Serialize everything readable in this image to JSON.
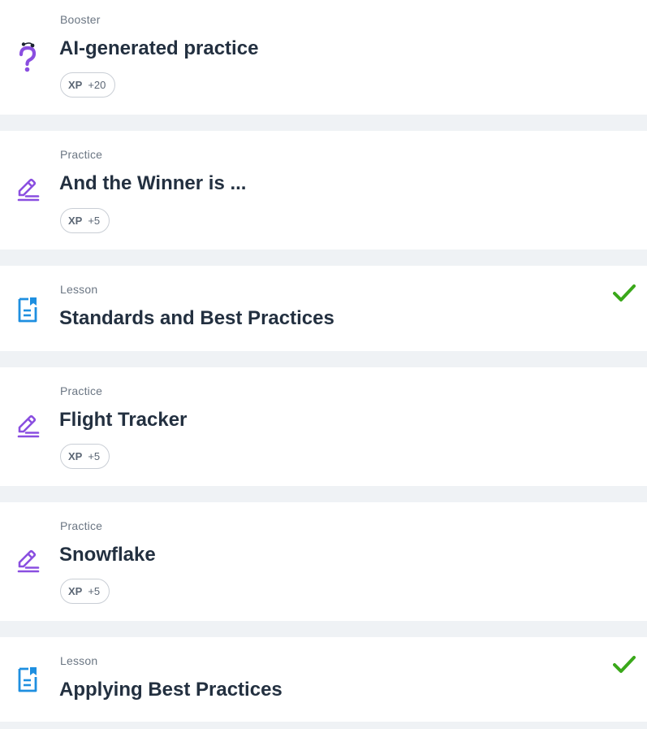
{
  "items": [
    {
      "type": "Booster",
      "title": "AI-generated practice",
      "icon": "question-mark-icon",
      "xp_label": "XP",
      "xp_value": "+20",
      "completed": false
    },
    {
      "type": "Practice",
      "title": "And the Winner is ...",
      "icon": "pencil-icon",
      "xp_label": "XP",
      "xp_value": "+5",
      "completed": false
    },
    {
      "type": "Lesson",
      "title": "Standards and Best Practices",
      "icon": "lesson-document-icon",
      "completed": true
    },
    {
      "type": "Practice",
      "title": "Flight Tracker",
      "icon": "pencil-icon",
      "xp_label": "XP",
      "xp_value": "+5",
      "completed": false
    },
    {
      "type": "Practice",
      "title": "Snowflake",
      "icon": "pencil-icon",
      "xp_label": "XP",
      "xp_value": "+5",
      "completed": false
    },
    {
      "type": "Lesson",
      "title": "Applying Best Practices",
      "icon": "lesson-document-icon",
      "completed": true
    }
  ],
  "colors": {
    "accent_purple": "#8a4ee0",
    "lesson_blue": "#1e8fe0",
    "check_green": "#3aa81a",
    "separator": "#eff2f5"
  }
}
